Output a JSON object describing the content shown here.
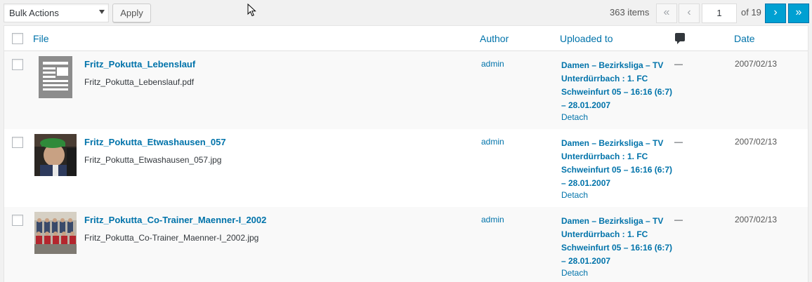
{
  "toolbar": {
    "bulk_actions": "Bulk Actions",
    "apply": "Apply",
    "items_count": "363 items",
    "first": "«",
    "prev": "‹",
    "current_page": "1",
    "of_pages": "of 19",
    "next": "›",
    "last": "»"
  },
  "columns": {
    "file": "File",
    "author": "Author",
    "uploaded_to": "Uploaded to",
    "comments_icon": "comment-icon",
    "date": "Date"
  },
  "rows": [
    {
      "title": "Fritz_Pokutta_Lebenslauf",
      "filename": "Fritz_Pokutta_Lebenslauf.pdf",
      "author": "admin",
      "uploaded_to": "Damen – Bezirksliga – TV Unterdürrbach : 1. FC Schweinfurt 05 – 16:16 (6:7) – 28.01.2007",
      "detach": "Detach",
      "comments": "—",
      "date": "2007/02/13",
      "thumb": "document-icon"
    },
    {
      "title": "Fritz_Pokutta_Etwashausen_057",
      "filename": "Fritz_Pokutta_Etwashausen_057.jpg",
      "author": "admin",
      "uploaded_to": "Damen – Bezirksliga – TV Unterdürrbach : 1. FC Schweinfurt 05 – 16:16 (6:7) – 28.01.2007",
      "detach": "Detach",
      "comments": "—",
      "date": "2007/02/13",
      "thumb": "portrait-photo"
    },
    {
      "title": "Fritz_Pokutta_Co-Trainer_Maenner-I_2002",
      "filename": "Fritz_Pokutta_Co-Trainer_Maenner-I_2002.jpg",
      "author": "admin",
      "uploaded_to": "Damen – Bezirksliga – TV Unterdürrbach : 1. FC Schweinfurt 05 – 16:16 (6:7) – 28.01.2007",
      "detach": "Detach",
      "comments": "—",
      "date": "2007/02/13",
      "thumb": "team-photo"
    }
  ],
  "colors": {
    "link": "#0073aa",
    "active_nav": "#00a0d2",
    "background": "#f1f1f1"
  }
}
